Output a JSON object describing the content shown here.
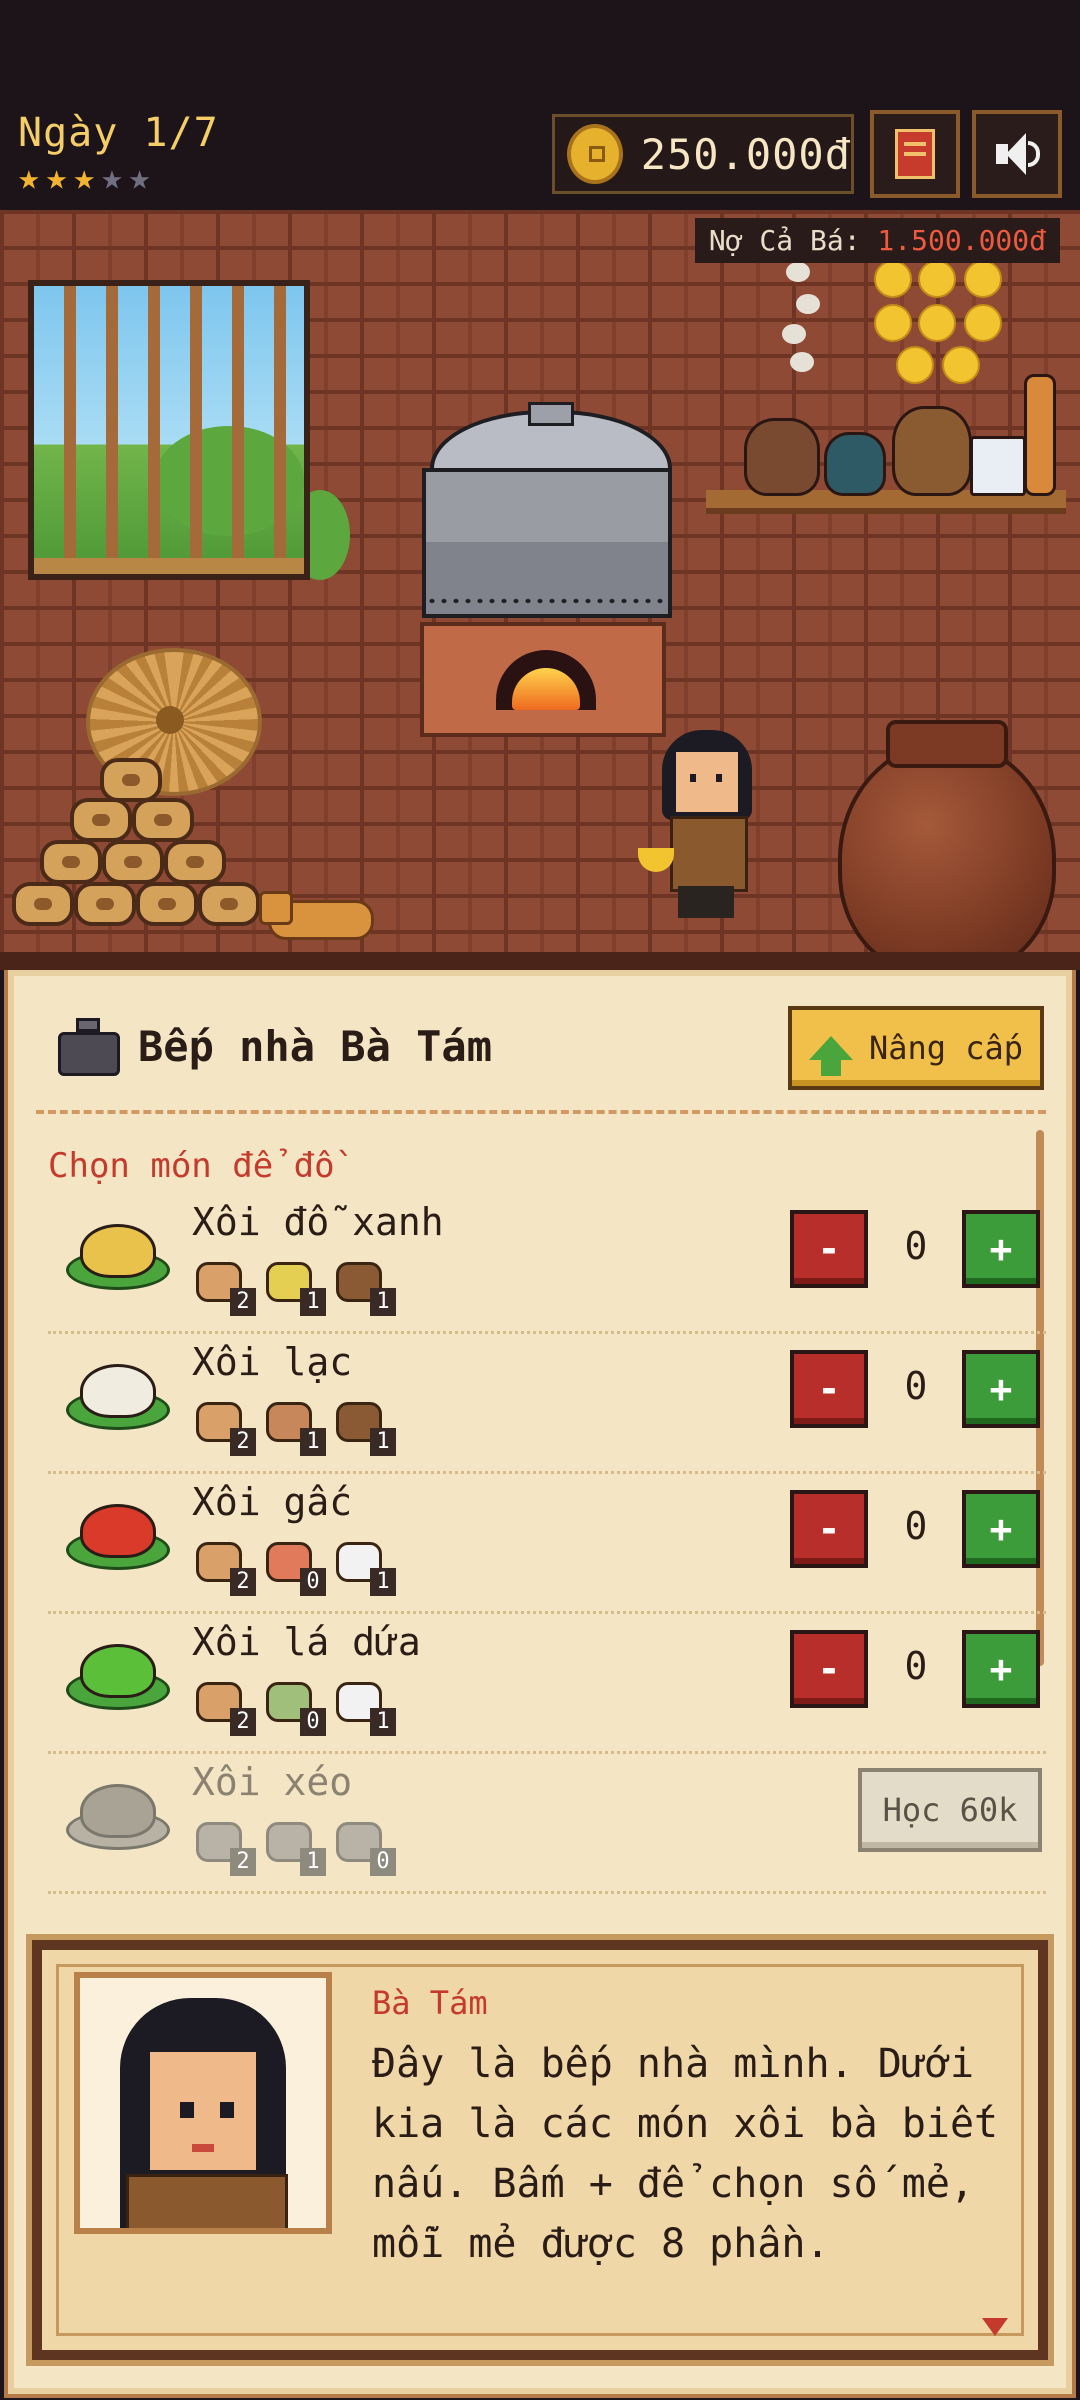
{
  "hud": {
    "day_label": "Ngày 1/7",
    "stars": {
      "filled": 3,
      "total": 5
    },
    "money": "250.000đ",
    "debt_label": "Nợ Cả Bá: ",
    "debt_amount": "1.500.000đ",
    "icons": {
      "coin": "coin-icon",
      "book": "book-icon",
      "sound": "speaker-icon"
    }
  },
  "kitchen": {
    "title": "Bếp nhà Bà Tám",
    "upgrade_label": "Nâng cấp",
    "section_label": "Chọn món để đồ",
    "recipes": [
      {
        "name": "Xôi đỗ xanh",
        "locked": false,
        "qty": "0",
        "ingredients": [
          {
            "name": "rice-bag-icon",
            "count": "2",
            "color": "#d9a06a"
          },
          {
            "name": "mung-bean-icon",
            "count": "1",
            "color": "#e4cf52"
          },
          {
            "name": "bowl-icon",
            "count": "1",
            "color": "#8a5a34"
          }
        ],
        "rice_color": "#e8c24a"
      },
      {
        "name": "Xôi lạc",
        "locked": false,
        "qty": "0",
        "ingredients": [
          {
            "name": "rice-bag-icon",
            "count": "2",
            "color": "#d9a06a"
          },
          {
            "name": "peanut-icon",
            "count": "1",
            "color": "#c8875a"
          },
          {
            "name": "bowl-icon",
            "count": "1",
            "color": "#8a5a34"
          }
        ],
        "rice_color": "#f1ece0"
      },
      {
        "name": "Xôi gấc",
        "locked": false,
        "qty": "0",
        "ingredients": [
          {
            "name": "rice-bag-icon",
            "count": "2",
            "color": "#d9a06a"
          },
          {
            "name": "gac-fruit-icon",
            "count": "0",
            "color": "#e07a5a"
          },
          {
            "name": "coconut-icon",
            "count": "1",
            "color": "#f2f2f2"
          }
        ],
        "rice_color": "#d93a2a"
      },
      {
        "name": "Xôi lá dứa",
        "locked": false,
        "qty": "0",
        "ingredients": [
          {
            "name": "rice-bag-icon",
            "count": "2",
            "color": "#d9a06a"
          },
          {
            "name": "pandan-leaf-icon",
            "count": "0",
            "color": "#9fbf7a"
          },
          {
            "name": "coconut-icon",
            "count": "1",
            "color": "#f2f2f2"
          }
        ],
        "rice_color": "#5cbf3a"
      },
      {
        "name": "Xôi xéo",
        "locked": true,
        "learn_label": "Học 60k",
        "ingredients": [
          {
            "name": "rice-bag-icon",
            "count": "2",
            "color": "#b8b3a6"
          },
          {
            "name": "bowl-icon",
            "count": "1",
            "color": "#b8b3a6"
          },
          {
            "name": "mung-bean-cake-icon",
            "count": "0",
            "color": "#b8b3a6"
          }
        ],
        "rice_color": "#a8a394"
      }
    ]
  },
  "dialog": {
    "speaker": "Bà Tám",
    "text": "Đây là bếp nhà mình. Dưới\nkia là các món xôi bà biết\nnấu. Bấm + để chọn số mẻ,\nmỗi mẻ được 8 phần."
  }
}
